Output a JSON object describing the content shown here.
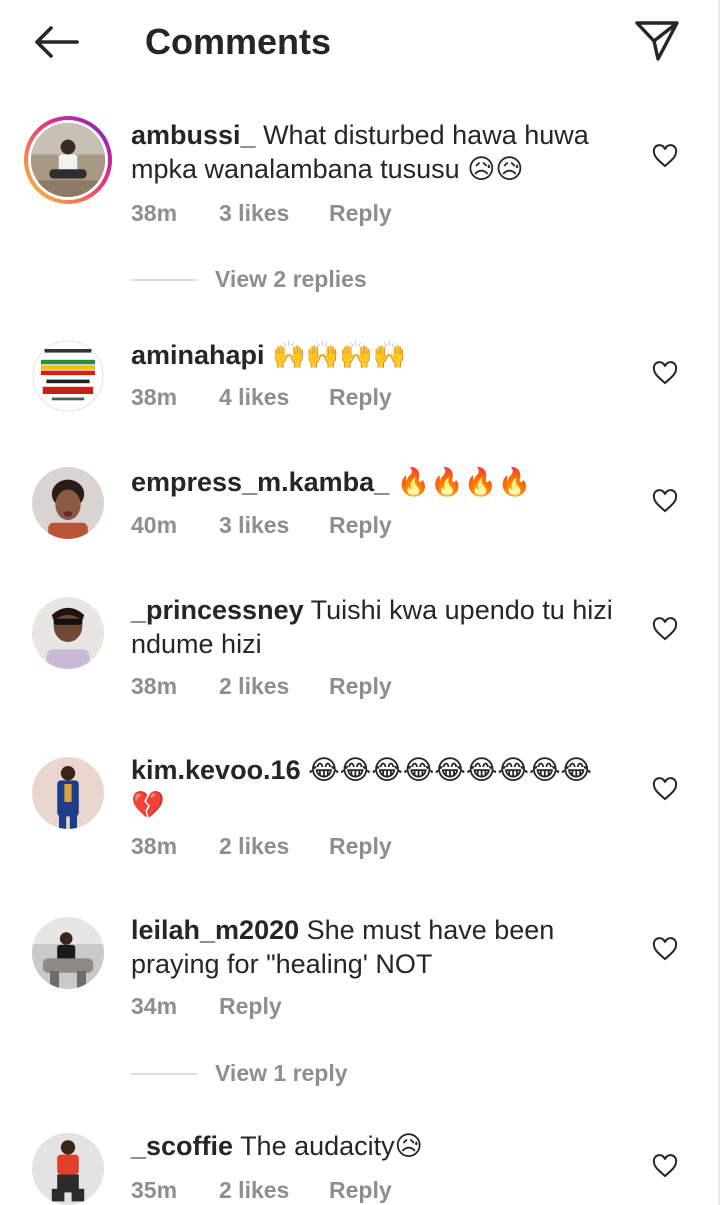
{
  "header": {
    "title": "Comments",
    "back_icon": "arrow-left-icon",
    "send_icon": "paper-plane-icon"
  },
  "comments": [
    {
      "username": "ambussi_",
      "text": "What disturbed hawa huwa mpka wanalambana tususu",
      "emoji": "😥😥",
      "time": "38m",
      "likes": "3 likes",
      "reply": "Reply",
      "view_replies": "View 2 replies"
    },
    {
      "username": "aminahapi",
      "text": "",
      "emoji": "🙌🙌🙌🙌",
      "time": "38m",
      "likes": "4 likes",
      "reply": "Reply"
    },
    {
      "username": "empress_m.kamba_",
      "text": "",
      "emoji": "🔥🔥🔥🔥",
      "time": "40m",
      "likes": "3 likes",
      "reply": "Reply"
    },
    {
      "username": "_princessney",
      "text": "Tuishi kwa upendo tu hizi ndume hizi",
      "emoji": "",
      "time": "38m",
      "likes": "2 likes",
      "reply": "Reply"
    },
    {
      "username": "kim.kevoo.16",
      "text": "",
      "emoji": "😂😂😂😂😂😂😂😂😂 💔",
      "time": "38m",
      "likes": "2 likes",
      "reply": "Reply"
    },
    {
      "username": "leilah_m2020",
      "text": "She must have been praying for \"healing' NOT",
      "emoji": "",
      "time": "34m",
      "likes": "",
      "reply": "Reply",
      "view_replies": "View 1 reply"
    },
    {
      "username": "_scoffie",
      "text": "The audacity",
      "emoji": "😥",
      "time": "35m",
      "likes": "2 likes",
      "reply": "Reply"
    }
  ]
}
